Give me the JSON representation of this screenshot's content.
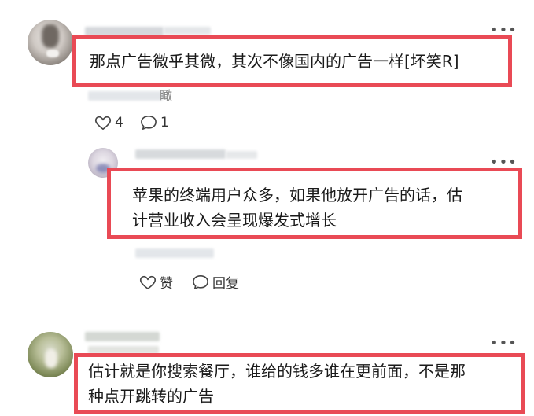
{
  "comments": [
    {
      "text": "那点广告微乎其微，其次不像国内的广告一样[坏笑R]",
      "stray_char": "瞰",
      "likes": "4",
      "replies": "1"
    },
    {
      "line1": "苹果的终端用户众多，如果他放开广告的话，估",
      "line2": "计营业收入会呈现爆发式增长",
      "like_label": "赞",
      "reply_label": "回复"
    },
    {
      "line1": "估计就是你搜索餐厅，谁给的钱多谁在更前面，不是那",
      "line2": "种点开跳转的广告"
    }
  ],
  "icons": {
    "more": "more-dots-icon",
    "like": "heart-icon",
    "comment": "comment-bubble-icon"
  },
  "colors": {
    "highlight_border": "#e94a55"
  }
}
